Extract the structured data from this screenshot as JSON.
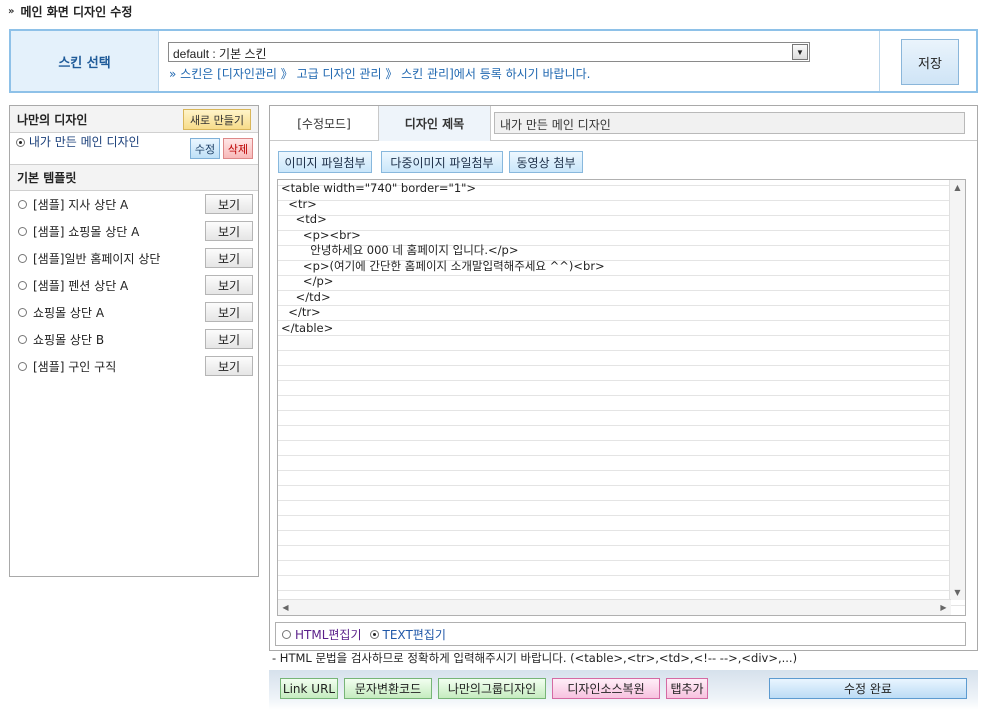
{
  "header": {
    "arrow": "»",
    "title": "메인 화면 디자인 수정"
  },
  "skin": {
    "label": "스킨 선택",
    "selected": "default : 기본 스킨",
    "note": "» 스킨은 [디자인관리 》 고급 디자인 관리 》 스킨 관리]에서 등록 하시기 바랍니다.",
    "save_label": "저장"
  },
  "my_design": {
    "heading": "나만의 디자인",
    "new_label": "새로 만들기",
    "item_label": "내가 만든 메인 디자인",
    "edit_label": "수정",
    "delete_label": "삭제"
  },
  "templates": {
    "heading": "기본 템플릿",
    "view_label": "보기",
    "items": [
      "[샘플] 지사 상단 A",
      "[샘플] 쇼핑몰 상단 A",
      "[샘플]일반 홈페이지 상단",
      "[샘플] 펜션 상단 A",
      "쇼핑몰 상단 A",
      "쇼핑몰 상단 B",
      "[샘플] 구인 구직"
    ]
  },
  "editor": {
    "mode_tab": "[수정모드]",
    "title_label": "디자인 제목",
    "title_value": "내가 만든 메인 디자인",
    "attach_image": "이미지 파일첨부",
    "attach_multi": "다중이미지 파일첨부",
    "attach_video": "동영상 첨부",
    "code": "<table width=\"740\" border=\"1\">\n  <tr>\n    <td>\n      <p><br>\n        안녕하세요 000 네 홈페이지 입니다.</p>\n      <p>(여기에 간단한 홈페이지 소개말입력해주세요 ^^)<br>\n      </p>\n    </td>\n  </tr>\n</table>",
    "html_mode": "HTML편집기",
    "text_mode": "TEXT편집기",
    "hint": "- HTML 문법을 검사하므로 정확하게 입력해주시기 바랍니다. (<table>,<tr>,<td>,<!-- -->,<div>,...)"
  },
  "toolbar": {
    "link_url": "Link URL",
    "char_convert": "문자변환코드",
    "my_group": "나만의그룹디자인",
    "restore": "디자인소스복원",
    "add_tab": "탭추가",
    "complete": "수정 완료"
  }
}
